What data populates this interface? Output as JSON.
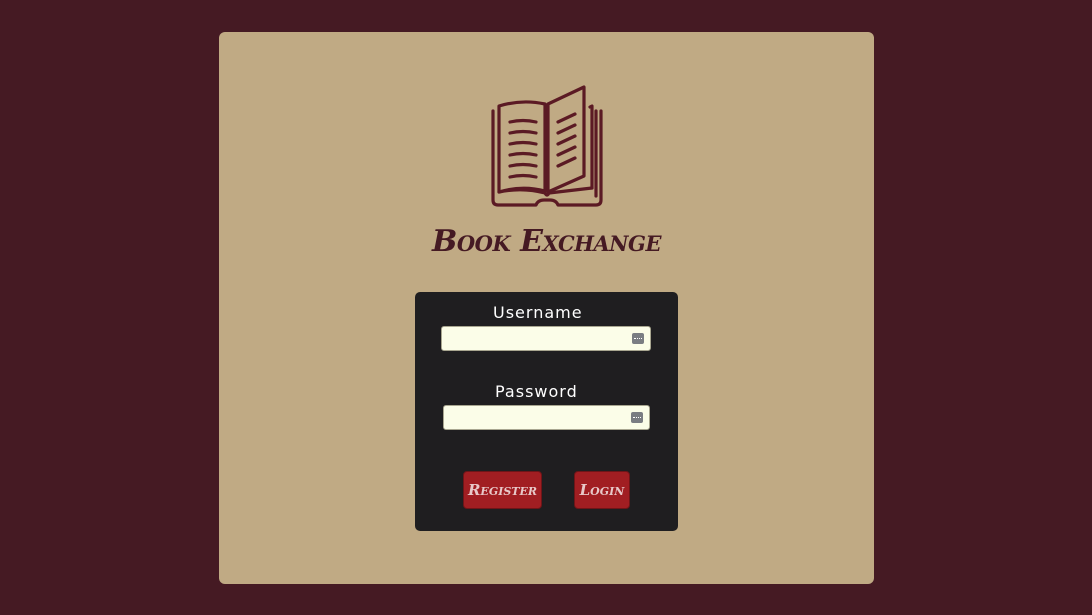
{
  "app": {
    "title": "Book Exchange",
    "logo_icon": "open-book-icon"
  },
  "login_form": {
    "username_label": "Username",
    "username_value": "",
    "password_label": "Password",
    "password_value": "",
    "autofill_icon": "password-manager-key-icon",
    "register_label": "Register",
    "login_label": "Login"
  },
  "colors": {
    "page_background": "#451a23",
    "card_background": "#c0aa84",
    "panel_background": "#1f1e20",
    "button_background": "#a11e22",
    "input_background": "#fbfde8"
  }
}
